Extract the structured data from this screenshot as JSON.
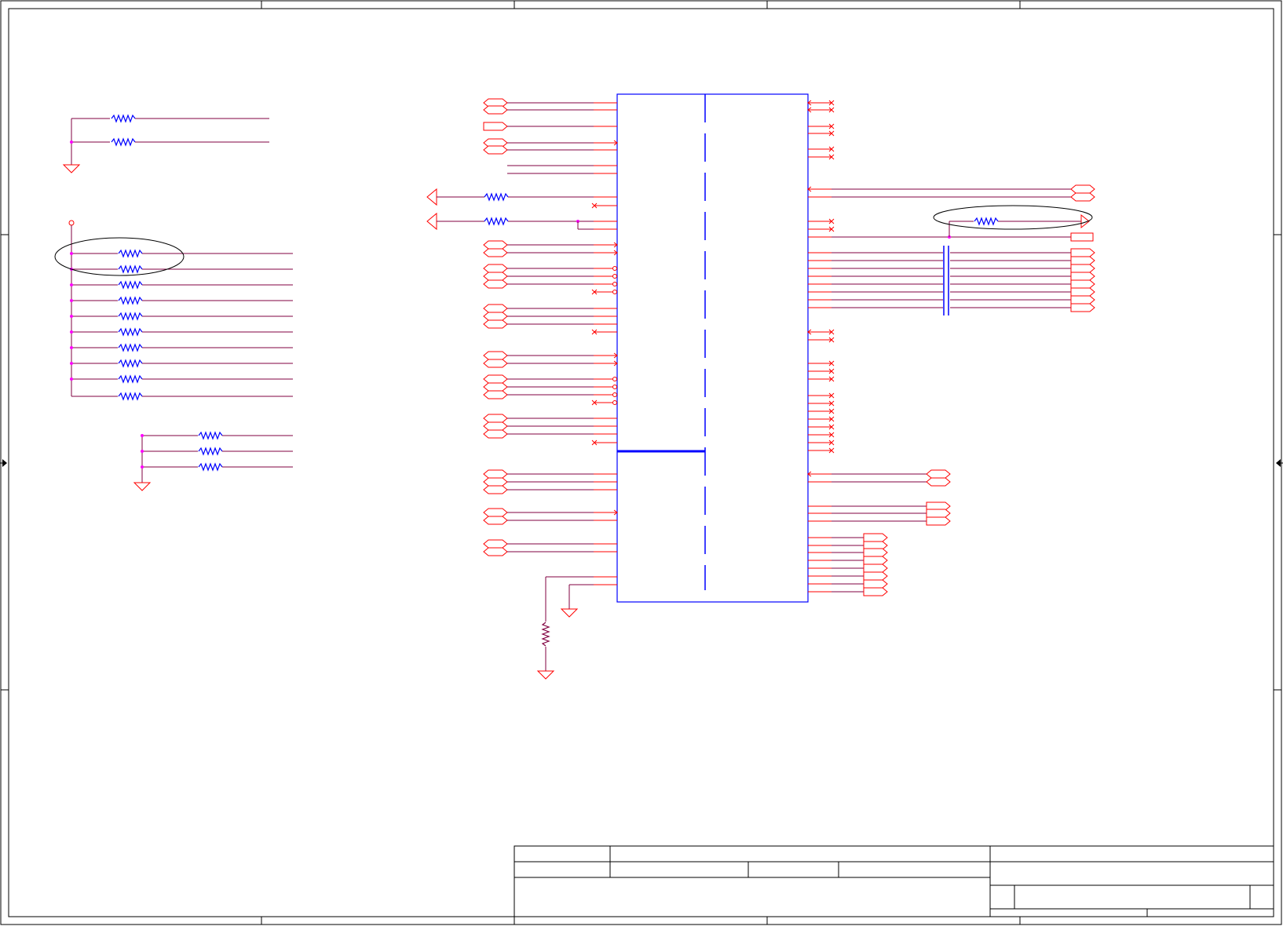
{
  "schematic": {
    "title_block": {
      "cells": [
        "",
        "",
        "",
        "",
        "",
        "",
        "",
        "",
        ""
      ]
    },
    "colors": {
      "frame": "#000000",
      "wire": "#800040",
      "pin": "#ff0000",
      "part": "#0000ff",
      "junction": "#ff00ff",
      "highlight": "#000000"
    },
    "icons": [
      "resistor-icon",
      "ground-icon",
      "capacitor-icon",
      "port-icon",
      "no-connect-icon",
      "power-pin-icon",
      "junction-icon"
    ]
  }
}
